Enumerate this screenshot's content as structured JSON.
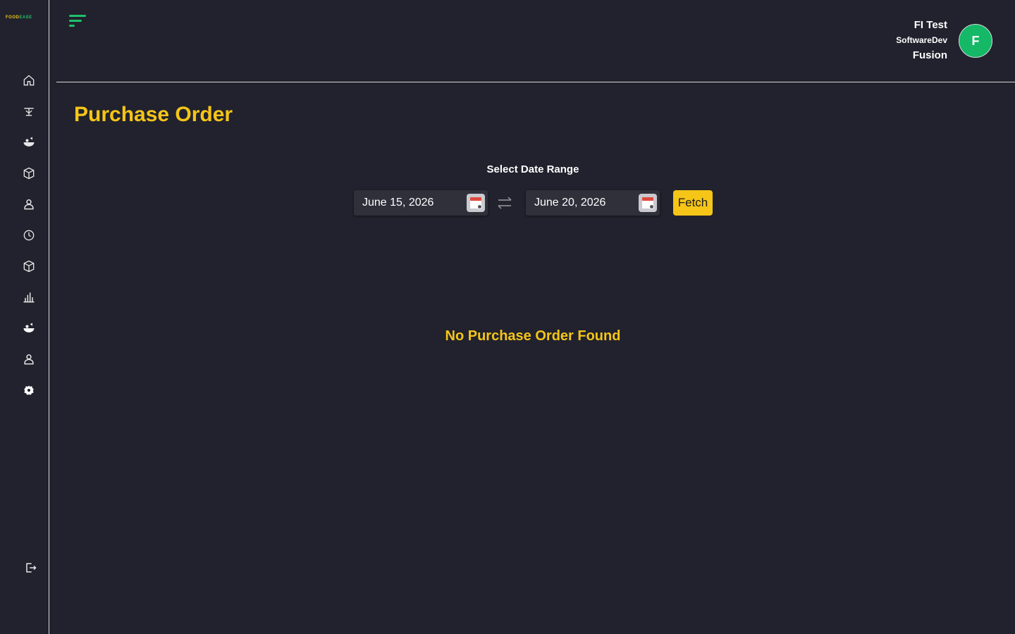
{
  "app": {
    "logo_part1": "FOOD",
    "logo_part2": "EASE",
    "brand_colors": {
      "yellow": "#f5c518",
      "green": "#1fc26b",
      "background": "#21222d"
    }
  },
  "sidebar": {
    "items": [
      {
        "name": "home",
        "icon": "home-icon"
      },
      {
        "name": "dining",
        "icon": "dining-table-icon"
      },
      {
        "name": "food",
        "icon": "food-bowl-icon"
      },
      {
        "name": "inventory",
        "icon": "box-icon"
      },
      {
        "name": "users",
        "icon": "user-icon"
      },
      {
        "name": "history",
        "icon": "clock-icon"
      },
      {
        "name": "products",
        "icon": "box-icon"
      },
      {
        "name": "reports",
        "icon": "bar-chart-icon"
      },
      {
        "name": "menu",
        "icon": "food-bowl-icon"
      },
      {
        "name": "staff",
        "icon": "user-icon"
      },
      {
        "name": "settings",
        "icon": "gear-icon"
      }
    ],
    "logout_icon": "logout-icon"
  },
  "header": {
    "user_name": "FI Test",
    "user_role": "SoftwareDev",
    "user_org": "Fusion",
    "avatar_initial": "F"
  },
  "main": {
    "title": "Purchase Order",
    "range_label": "Select Date Range",
    "start_date": "June 15, 2026",
    "end_date": "June 20, 2026",
    "fetch_label": "Fetch",
    "empty_message": "No Purchase Order Found"
  }
}
